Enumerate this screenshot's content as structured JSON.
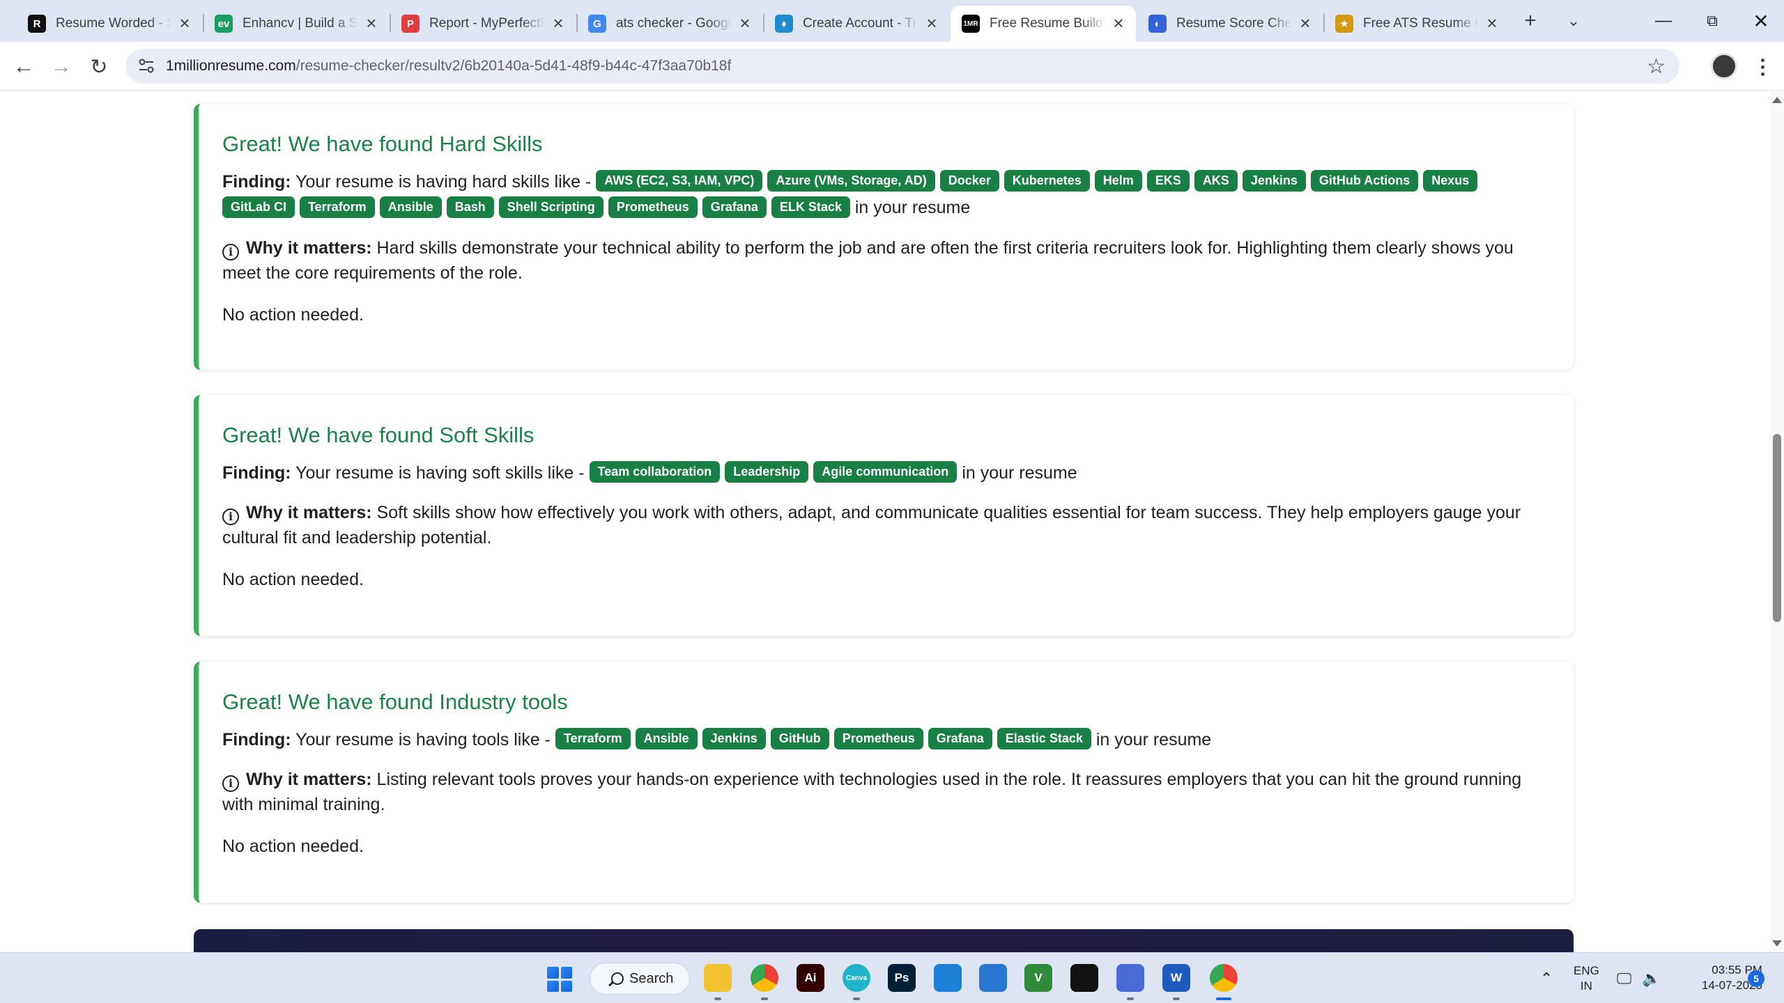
{
  "browser": {
    "tabs": [
      {
        "title": "Resume Worded - Sc",
        "icon": "resume-worded-icon",
        "fav_text": "R",
        "color": "#111111"
      },
      {
        "title": "Enhancv | Build a Sta",
        "icon": "enhancv-icon",
        "fav_text": "ev",
        "color": "#1b9e61"
      },
      {
        "title": "Report - MyPerfectR",
        "icon": "myperfectresume-icon",
        "fav_text": "P",
        "color": "#e03d3d"
      },
      {
        "title": "ats checker - Google",
        "icon": "google-icon",
        "fav_text": "G",
        "color": "#4285f4"
      },
      {
        "title": "Create Account - Try",
        "icon": "tealhq-icon",
        "fav_text": "♦",
        "color": "#1f8ccf"
      },
      {
        "title": "Free Resume Builder",
        "icon": "1mr-icon",
        "fav_text": "1MR",
        "color": "#000000"
      },
      {
        "title": "Resume Score Check",
        "icon": "resume-score-icon",
        "fav_text": "◐",
        "color": "#3463d9"
      },
      {
        "title": "Free ATS Resume Ch",
        "icon": "jobscan-icon",
        "fav_text": "★",
        "color": "#d49b12"
      }
    ],
    "active_tab": 5,
    "url_host": "1millionresume.com",
    "url_path": "/resume-checker/resultv2/6b20140a-5d41-48f9-b44c-47f3aa70b18f"
  },
  "sections": [
    {
      "title": "Great! We have found Hard Skills",
      "finding_label": "Finding:",
      "finding_prefix": "Your resume is having hard skills like -",
      "tags": [
        "AWS (EC2, S3, IAM, VPC)",
        "Azure (VMs, Storage, AD)",
        "Docker",
        "Kubernetes",
        "Helm",
        "EKS",
        "AKS",
        "Jenkins",
        "GitHub Actions",
        "Nexus",
        "GitLab CI",
        "Terraform",
        "Ansible",
        "Bash",
        "Shell Scripting",
        "Prometheus",
        "Grafana",
        "ELK Stack"
      ],
      "finding_suffix": "in your resume",
      "why_label": "Why it matters:",
      "why_text": "Hard skills demonstrate your technical ability to perform the job and are often the first criteria recruiters look for. Highlighting them clearly shows you meet the core requirements of the role.",
      "action": "No action needed."
    },
    {
      "title": "Great! We have found Soft Skills",
      "finding_label": "Finding:",
      "finding_prefix": "Your resume is having soft skills like -",
      "tags": [
        "Team collaboration",
        "Leadership",
        "Agile communication"
      ],
      "finding_suffix": "in your resume",
      "why_label": "Why it matters:",
      "why_text": "Soft skills show how effectively you work with others, adapt, and communicate qualities essential for team success. They help employers gauge your cultural fit and leadership potential.",
      "action": "No action needed."
    },
    {
      "title": "Great! We have found Industry tools",
      "finding_label": "Finding:",
      "finding_prefix": "Your resume is having tools like -",
      "tags": [
        "Terraform",
        "Ansible",
        "Jenkins",
        "GitHub",
        "Prometheus",
        "Grafana",
        "Elastic Stack"
      ],
      "finding_suffix": "in your resume",
      "why_label": "Why it matters:",
      "why_text": "Listing relevant tools proves your hands-on experience with technologies used in the role. It reassures employers that you can hit the ground running with minimal training.",
      "action": "No action needed."
    }
  ],
  "colors": {
    "accent_green": "#1c8348",
    "tag_green": "#187f45",
    "card_border": "#3dac5c"
  },
  "taskbar": {
    "search_label": "Search",
    "apps": [
      {
        "name": "file-explorer-icon",
        "label": "",
        "color": "#f2c230"
      },
      {
        "name": "chrome-profile-icon",
        "label": "",
        "color": "#4285f4"
      },
      {
        "name": "illustrator-icon",
        "label": "Ai",
        "color": "#330000"
      },
      {
        "name": "canva-icon",
        "label": "Canva",
        "color": "#20b3c9"
      },
      {
        "name": "photoshop-icon",
        "label": "Ps",
        "color": "#001e36"
      },
      {
        "name": "vscode-icon",
        "label": "",
        "color": "#1e7fd6"
      },
      {
        "name": "azure-data-studio-icon",
        "label": "",
        "color": "#2a77d1"
      },
      {
        "name": "vim-icon",
        "label": "V",
        "color": "#2f8a3a"
      },
      {
        "name": "capcut-icon",
        "label": "",
        "color": "#111111"
      },
      {
        "name": "snipping-icon",
        "label": "",
        "color": "#4a6ad8"
      },
      {
        "name": "word-icon",
        "label": "W",
        "color": "#1f5bbf"
      },
      {
        "name": "chrome-icon",
        "label": "",
        "color": "#4285f4"
      }
    ],
    "lang_line1": "ENG",
    "lang_line2": "IN",
    "time": "03:55 PM",
    "date": "14-07-2025",
    "notification_count": "5"
  }
}
